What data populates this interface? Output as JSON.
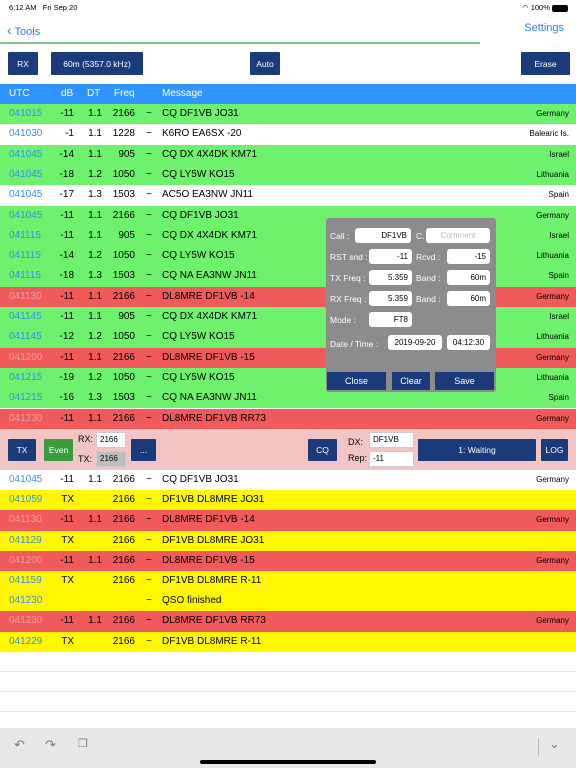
{
  "status": {
    "time": "6:12 AM",
    "date": "Fri Sep 20",
    "battery": "100%"
  },
  "nav": {
    "back_label": "Tools",
    "settings_label": "Settings"
  },
  "toolbar": {
    "rx_label": "RX",
    "band_label": "60m (5357.0 kHz)",
    "auto_label": "Auto",
    "erase_label": "Erase"
  },
  "header": {
    "utc": "UTC",
    "db": "dB",
    "dt": "DT",
    "freq": "Freq",
    "message": "Message"
  },
  "rx_rows": [
    {
      "color": "green",
      "utc": "041015",
      "db": "-11",
      "dt": "1.1",
      "freq": "2166",
      "tilde": "~",
      "msg": "CQ DF1VB JO31",
      "country": "Germany"
    },
    {
      "color": "white",
      "utc": "041030",
      "db": "-1",
      "dt": "1.1",
      "freq": "1228",
      "tilde": "~",
      "msg": "K6RO EA6SX -20",
      "country": "Balearic Is."
    },
    {
      "color": "green",
      "utc": "041045",
      "db": "-14",
      "dt": "1.1",
      "freq": "905",
      "tilde": "~",
      "msg": "CQ DX 4X4DK KM71",
      "country": "Israel"
    },
    {
      "color": "green",
      "utc": "041045",
      "db": "-18",
      "dt": "1.2",
      "freq": "1050",
      "tilde": "~",
      "msg": "CQ LY5W KO15",
      "country": "Lithuania"
    },
    {
      "color": "white",
      "utc": "041045",
      "db": "-17",
      "dt": "1.3",
      "freq": "1503",
      "tilde": "~",
      "msg": "AC5O EA3NW JN11",
      "country": "Spain"
    },
    {
      "color": "green",
      "utc": "041045",
      "db": "-11",
      "dt": "1.1",
      "freq": "2166",
      "tilde": "~",
      "msg": "CQ DF1VB JO31",
      "country": "Germany"
    },
    {
      "color": "green",
      "utc": "041115",
      "db": "-11",
      "dt": "1.1",
      "freq": "905",
      "tilde": "~",
      "msg": "CQ DX 4X4DK KM71",
      "country": "Israel"
    },
    {
      "color": "green",
      "utc": "041115",
      "db": "-14",
      "dt": "1.2",
      "freq": "1050",
      "tilde": "~",
      "msg": "CQ LY5W KO15",
      "country": "Lithuania"
    },
    {
      "color": "green",
      "utc": "041115",
      "db": "-18",
      "dt": "1.3",
      "freq": "1503",
      "tilde": "~",
      "msg": "CQ NA EA3NW JN11",
      "country": "Spain"
    },
    {
      "color": "red",
      "utc": "041130",
      "db": "-11",
      "dt": "1.1",
      "freq": "2166",
      "tilde": "~",
      "msg": "DL8MRE DF1VB -14",
      "country": "Germany"
    },
    {
      "color": "green",
      "utc": "041145",
      "db": "-11",
      "dt": "1.1",
      "freq": "905",
      "tilde": "~",
      "msg": "CQ DX 4X4DK KM71",
      "country": "Israel"
    },
    {
      "color": "green",
      "utc": "041145",
      "db": "-12",
      "dt": "1.2",
      "freq": "1050",
      "tilde": "~",
      "msg": "CQ LY5W KO15",
      "country": "Lithuania"
    },
    {
      "color": "red",
      "utc": "041200",
      "db": "-11",
      "dt": "1.1",
      "freq": "2166",
      "tilde": "~",
      "msg": "DL8MRE DF1VB -15",
      "country": "Germany"
    },
    {
      "color": "green",
      "utc": "041215",
      "db": "-19",
      "dt": "1.2",
      "freq": "1050",
      "tilde": "~",
      "msg": "CQ LY5W KO15",
      "country": "Lithuania"
    },
    {
      "color": "green",
      "utc": "041215",
      "db": "-16",
      "dt": "1.3",
      "freq": "1503",
      "tilde": "~",
      "msg": "CQ NA EA3NW JN11",
      "country": "Spain"
    },
    {
      "color": "red",
      "utc": "041230",
      "db": "-11",
      "dt": "1.1",
      "freq": "2166",
      "tilde": "~",
      "msg": "DL8MRE DF1VB RR73",
      "country": "Germany"
    }
  ],
  "txbar": {
    "tx_label": "TX",
    "even_label": "Even",
    "rx_label": "RX:",
    "rx_value": "2166",
    "tx_field_label": "TX:",
    "tx_value": "2166",
    "dots_label": "...",
    "cq_label": "CQ",
    "dx_label": "DX:",
    "dx_value": "DF1VB",
    "rep_label": "Rep:",
    "rep_value": "-11",
    "state_label": "1: Waiting",
    "log_label": "LOG"
  },
  "qso_rows": [
    {
      "color": "white",
      "utc": "041045",
      "db": "-11",
      "dt": "1.1",
      "freq": "2166",
      "tilde": "~",
      "msg": "CQ DF1VB JO31",
      "country": "Germany"
    },
    {
      "color": "yellow",
      "utc": "041059",
      "db": "TX",
      "dt": "",
      "freq": "2166",
      "tilde": "~",
      "msg": "DF1VB DL8MRE JO31",
      "country": ""
    },
    {
      "color": "red",
      "utc": "041130",
      "db": "-11",
      "dt": "1.1",
      "freq": "2166",
      "tilde": "~",
      "msg": "DL8MRE DF1VB -14",
      "country": "Germany"
    },
    {
      "color": "yellow",
      "utc": "041129",
      "db": "TX",
      "dt": "",
      "freq": "2166",
      "tilde": "~",
      "msg": "DF1VB DL8MRE JO31",
      "country": ""
    },
    {
      "color": "red",
      "utc": "041200",
      "db": "-11",
      "dt": "1.1",
      "freq": "2166",
      "tilde": "~",
      "msg": "DL8MRE DF1VB -15",
      "country": "Germany"
    },
    {
      "color": "yellow",
      "utc": "041159",
      "db": "TX",
      "dt": "",
      "freq": "2166",
      "tilde": "~",
      "msg": "DF1VB DL8MRE R-11",
      "country": ""
    },
    {
      "color": "yellow",
      "utc": "041230",
      "db": "",
      "dt": "",
      "freq": "",
      "tilde": "~",
      "msg": "QSO finished",
      "country": ""
    },
    {
      "color": "red",
      "utc": "041230",
      "db": "-11",
      "dt": "1.1",
      "freq": "2166",
      "tilde": "~",
      "msg": "DL8MRE DF1VB RR73",
      "country": "Germany"
    },
    {
      "color": "yellow",
      "utc": "041229",
      "db": "TX",
      "dt": "",
      "freq": "2166",
      "tilde": "~",
      "msg": "DF1VB DL8MRE R-11",
      "country": ""
    }
  ],
  "popup": {
    "call_label": "Call :",
    "call_value": "DF1VB",
    "c_label": "C.",
    "comment_placeholder": "Comment",
    "rst_label": "RST snd :",
    "rst_value": "-11",
    "rcvd_label": "Rcvd :",
    "rcvd_value": "-15",
    "txfreq_label": "TX Freq :",
    "txfreq_value": "5.359",
    "band_label": "Band :",
    "band_value": "60m",
    "rxfreq_label": "RX Freq :",
    "rxfreq_value": "5.359",
    "band2_label": "Band :",
    "band2_value": "60m",
    "mode_label": "Mode :",
    "mode_value": "FT8",
    "datetime_label": "Date / Time :",
    "date_value": "2019-09-20",
    "time_value": "04:12:30",
    "close_label": "Close",
    "clear_label": "Clear",
    "save_label": "Save"
  },
  "colors": {
    "green": "#6ef26e",
    "red": "#f05a5a",
    "yellow": "#fff700",
    "navy": "#1b3a79",
    "header_blue": "#2f94ff",
    "link_blue": "#2f7cf6"
  },
  "icons": [
    "wifi-icon",
    "battery-icon",
    "chevron-left-icon",
    "undo-icon",
    "redo-icon",
    "clipboard-icon",
    "chevron-down-icon"
  ]
}
